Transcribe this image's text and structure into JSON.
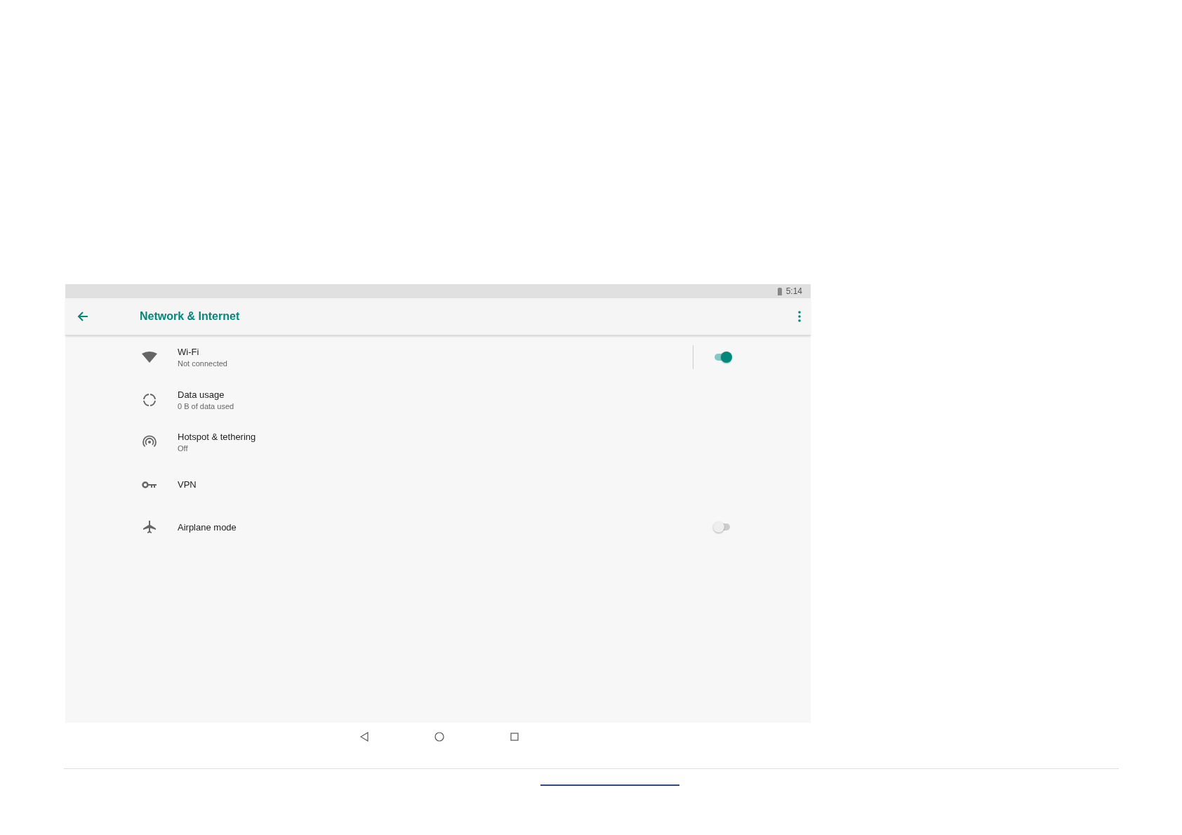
{
  "status_bar": {
    "time": "5:14"
  },
  "toolbar": {
    "title": "Network & Internet"
  },
  "settings": [
    {
      "kind": "toggle",
      "title": "Wi-Fi",
      "summary": "Not connected",
      "on": true
    },
    {
      "kind": "plain",
      "title": "Data usage",
      "summary": "0 B of data used"
    },
    {
      "kind": "plain",
      "title": "Hotspot & tethering",
      "summary": "Off"
    },
    {
      "kind": "plain",
      "title": "VPN"
    },
    {
      "kind": "switch",
      "title": "Airplane mode",
      "on": false
    }
  ]
}
